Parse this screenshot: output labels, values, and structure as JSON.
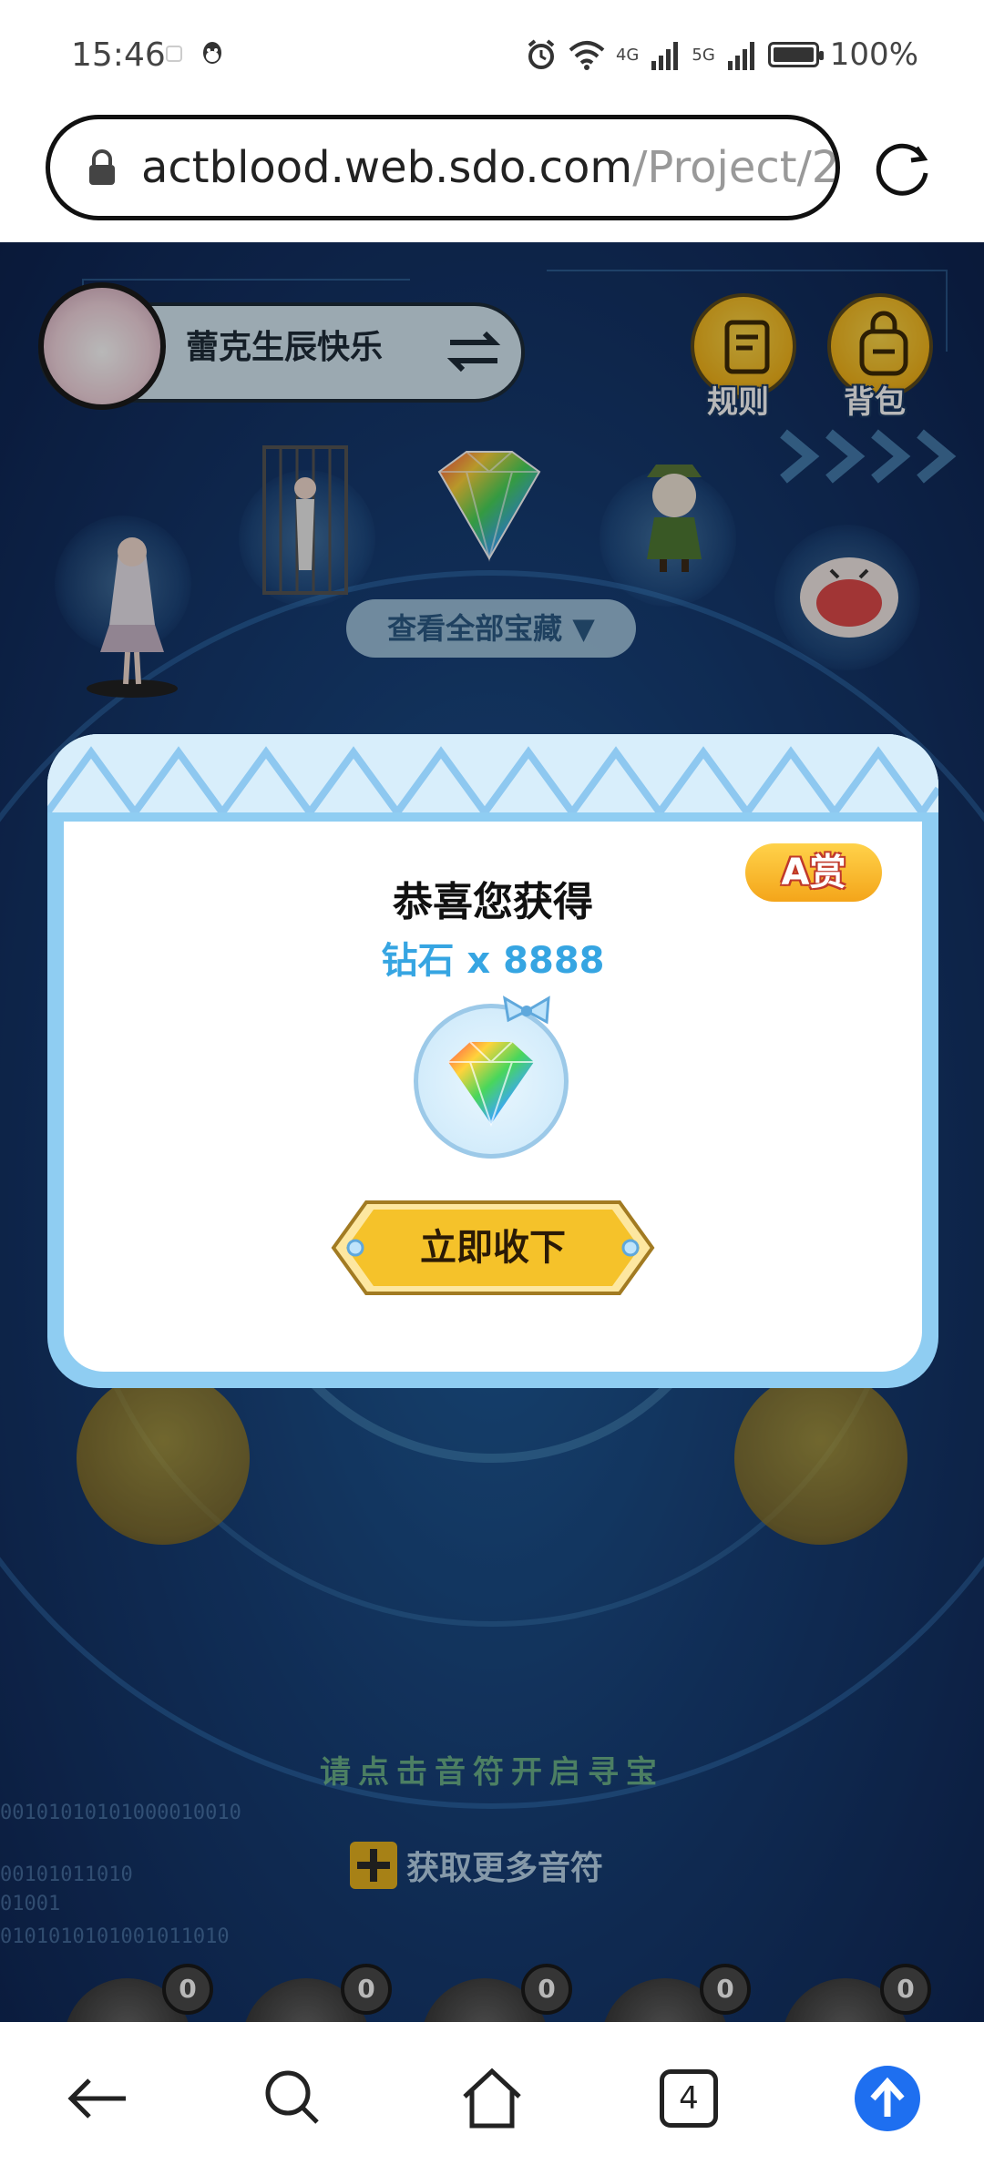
{
  "status_bar": {
    "time": "15:46",
    "network_4g": "4G",
    "network_5g": "5G",
    "battery": "100%",
    "icons": [
      "qq-icon",
      "alarm-icon",
      "wifi-icon",
      "signal-icon",
      "battery-icon"
    ]
  },
  "browser": {
    "url_host": "actblood.web.sdo.com",
    "url_path": "/Project/2"
  },
  "game": {
    "profile_name": "蕾克生辰快乐",
    "rules_label": "规则",
    "bag_label": "背包",
    "view_all_label": "查看全部宝藏 ▼",
    "hint": "请点击音符开启寻宝",
    "more_notes_label": "获取更多音符",
    "binary_lines": [
      "00101010101000010010",
      "00101011010",
      "01001",
      "0101010101001011010"
    ],
    "note_slots": [
      {
        "count": "0"
      },
      {
        "count": "0"
      },
      {
        "count": "0"
      },
      {
        "count": "0"
      },
      {
        "count": "0"
      }
    ]
  },
  "modal": {
    "title": "恭喜您获得",
    "prize": "钻石 x 8888",
    "badge": "A赏",
    "accept_label": "立即收下"
  },
  "bottom_nav": {
    "tab_count": "4",
    "accent_color": "#1e6ff0"
  }
}
